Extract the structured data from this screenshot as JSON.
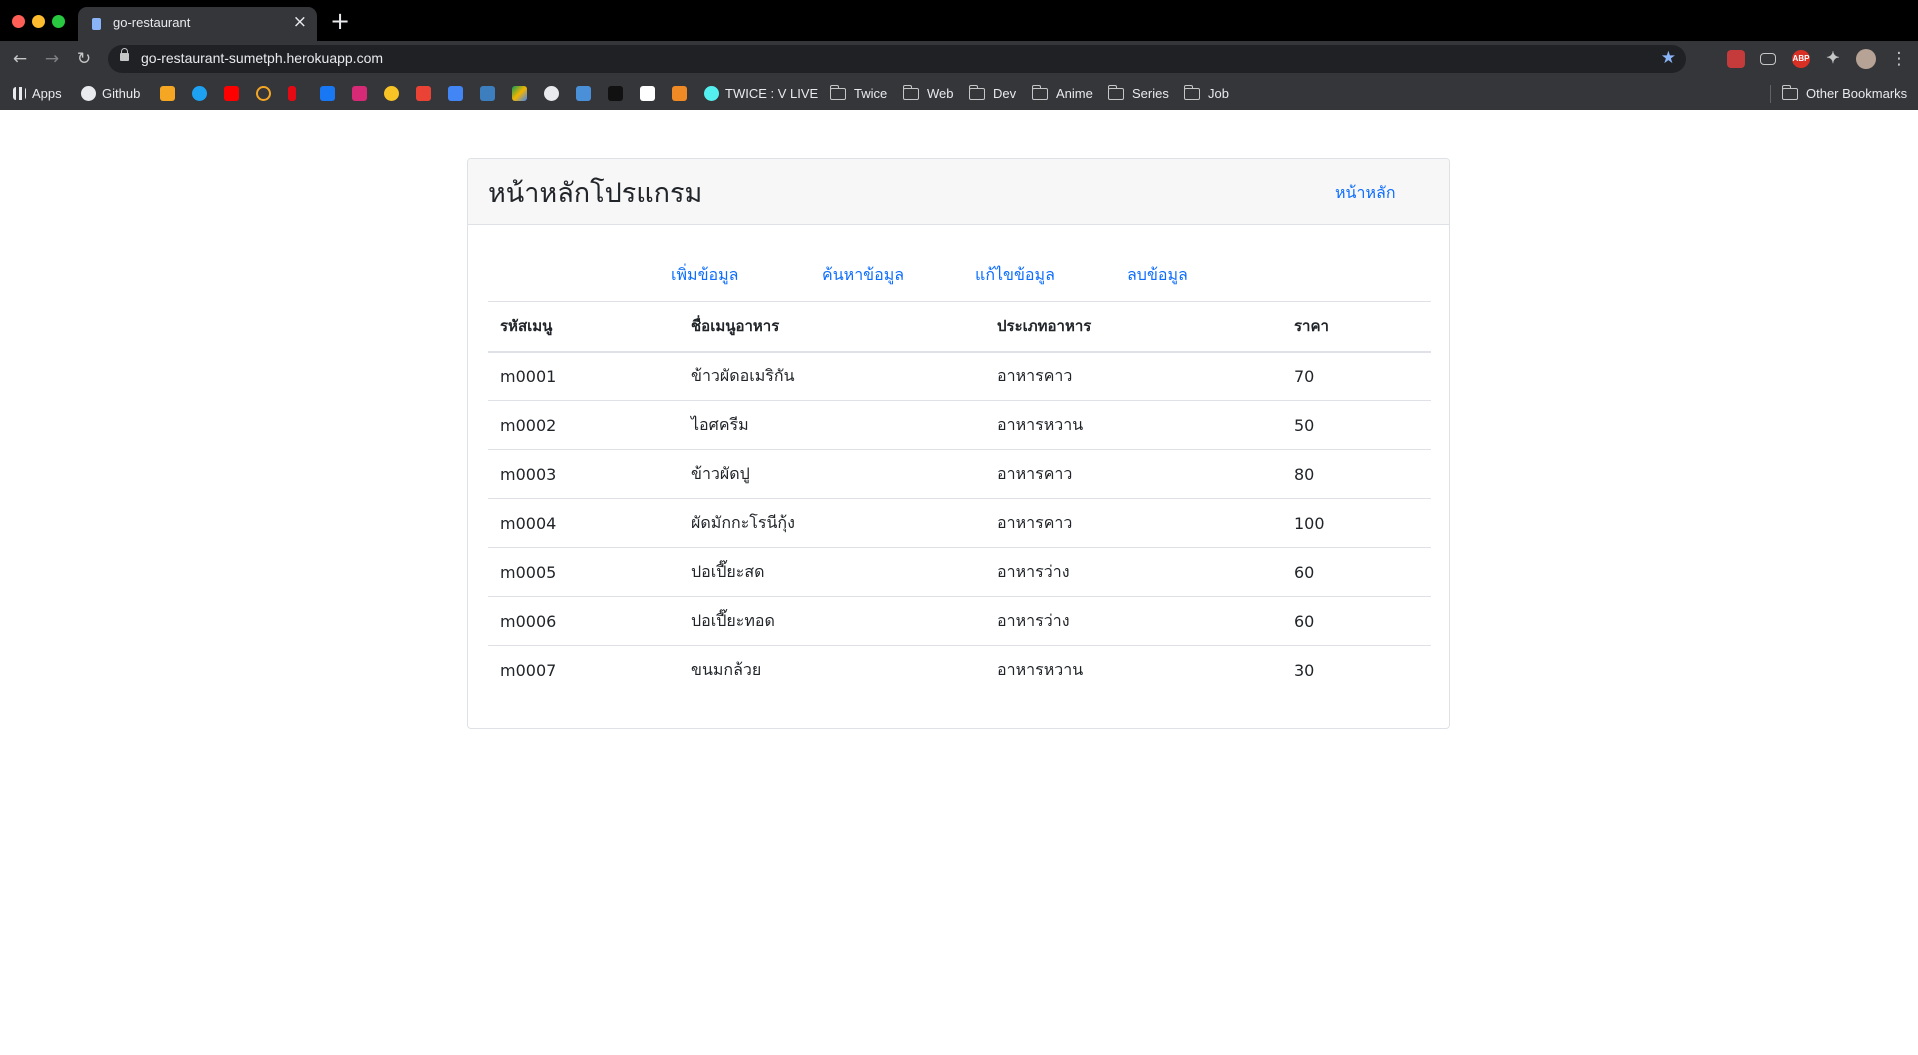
{
  "browser": {
    "tab_title": "go-restaurant",
    "tab_close": "×",
    "new_tab": "+",
    "url": "go-restaurant-sumetph.herokuapp.com",
    "bookmarks": {
      "apps": "Apps",
      "github": "Github",
      "twice_vlive": "TWICE : V LIVE",
      "folders": [
        "Twice",
        "Web",
        "Dev",
        "Anime",
        "Series",
        "Job"
      ],
      "other": "Other Bookmarks"
    },
    "extensions": {
      "abp": "ABP"
    }
  },
  "page": {
    "title": "หน้าหลักโปรแกรม",
    "home_link": "หน้าหลัก",
    "actions": {
      "add": "เพิ่มข้อมูล",
      "search": "ค้นหาข้อมูล",
      "edit": "แก้ไขข้อมูล",
      "delete": "ลบข้อมูล"
    },
    "table": {
      "headers": [
        "รหัสเมนู",
        "ชื่อเมนูอาหาร",
        "ประเภทอาหาร",
        "ราคา"
      ],
      "rows": [
        [
          "m0001",
          "ข้าวผัดอเมริกัน",
          "อาหารคาว",
          "70"
        ],
        [
          "m0002",
          "ไอศครีม",
          "อาหารหวาน",
          "50"
        ],
        [
          "m0003",
          "ข้าวผัดปู",
          "อาหารคาว",
          "80"
        ],
        [
          "m0004",
          "ผัดมักกะโรนีกุ้ง",
          "อาหารคาว",
          "100"
        ],
        [
          "m0005",
          "ปอเปี๊ยะสด",
          "อาหารว่าง",
          "60"
        ],
        [
          "m0006",
          "ปอเปี๊ยะทอด",
          "อาหารว่าง",
          "60"
        ],
        [
          "m0007",
          "ขนมกล้วย",
          "อาหารหวาน",
          "30"
        ]
      ]
    }
  },
  "colors": {
    "link": "#0d6efd",
    "header_bg": "#f7f7f7",
    "chrome_dark": "#35363a"
  }
}
